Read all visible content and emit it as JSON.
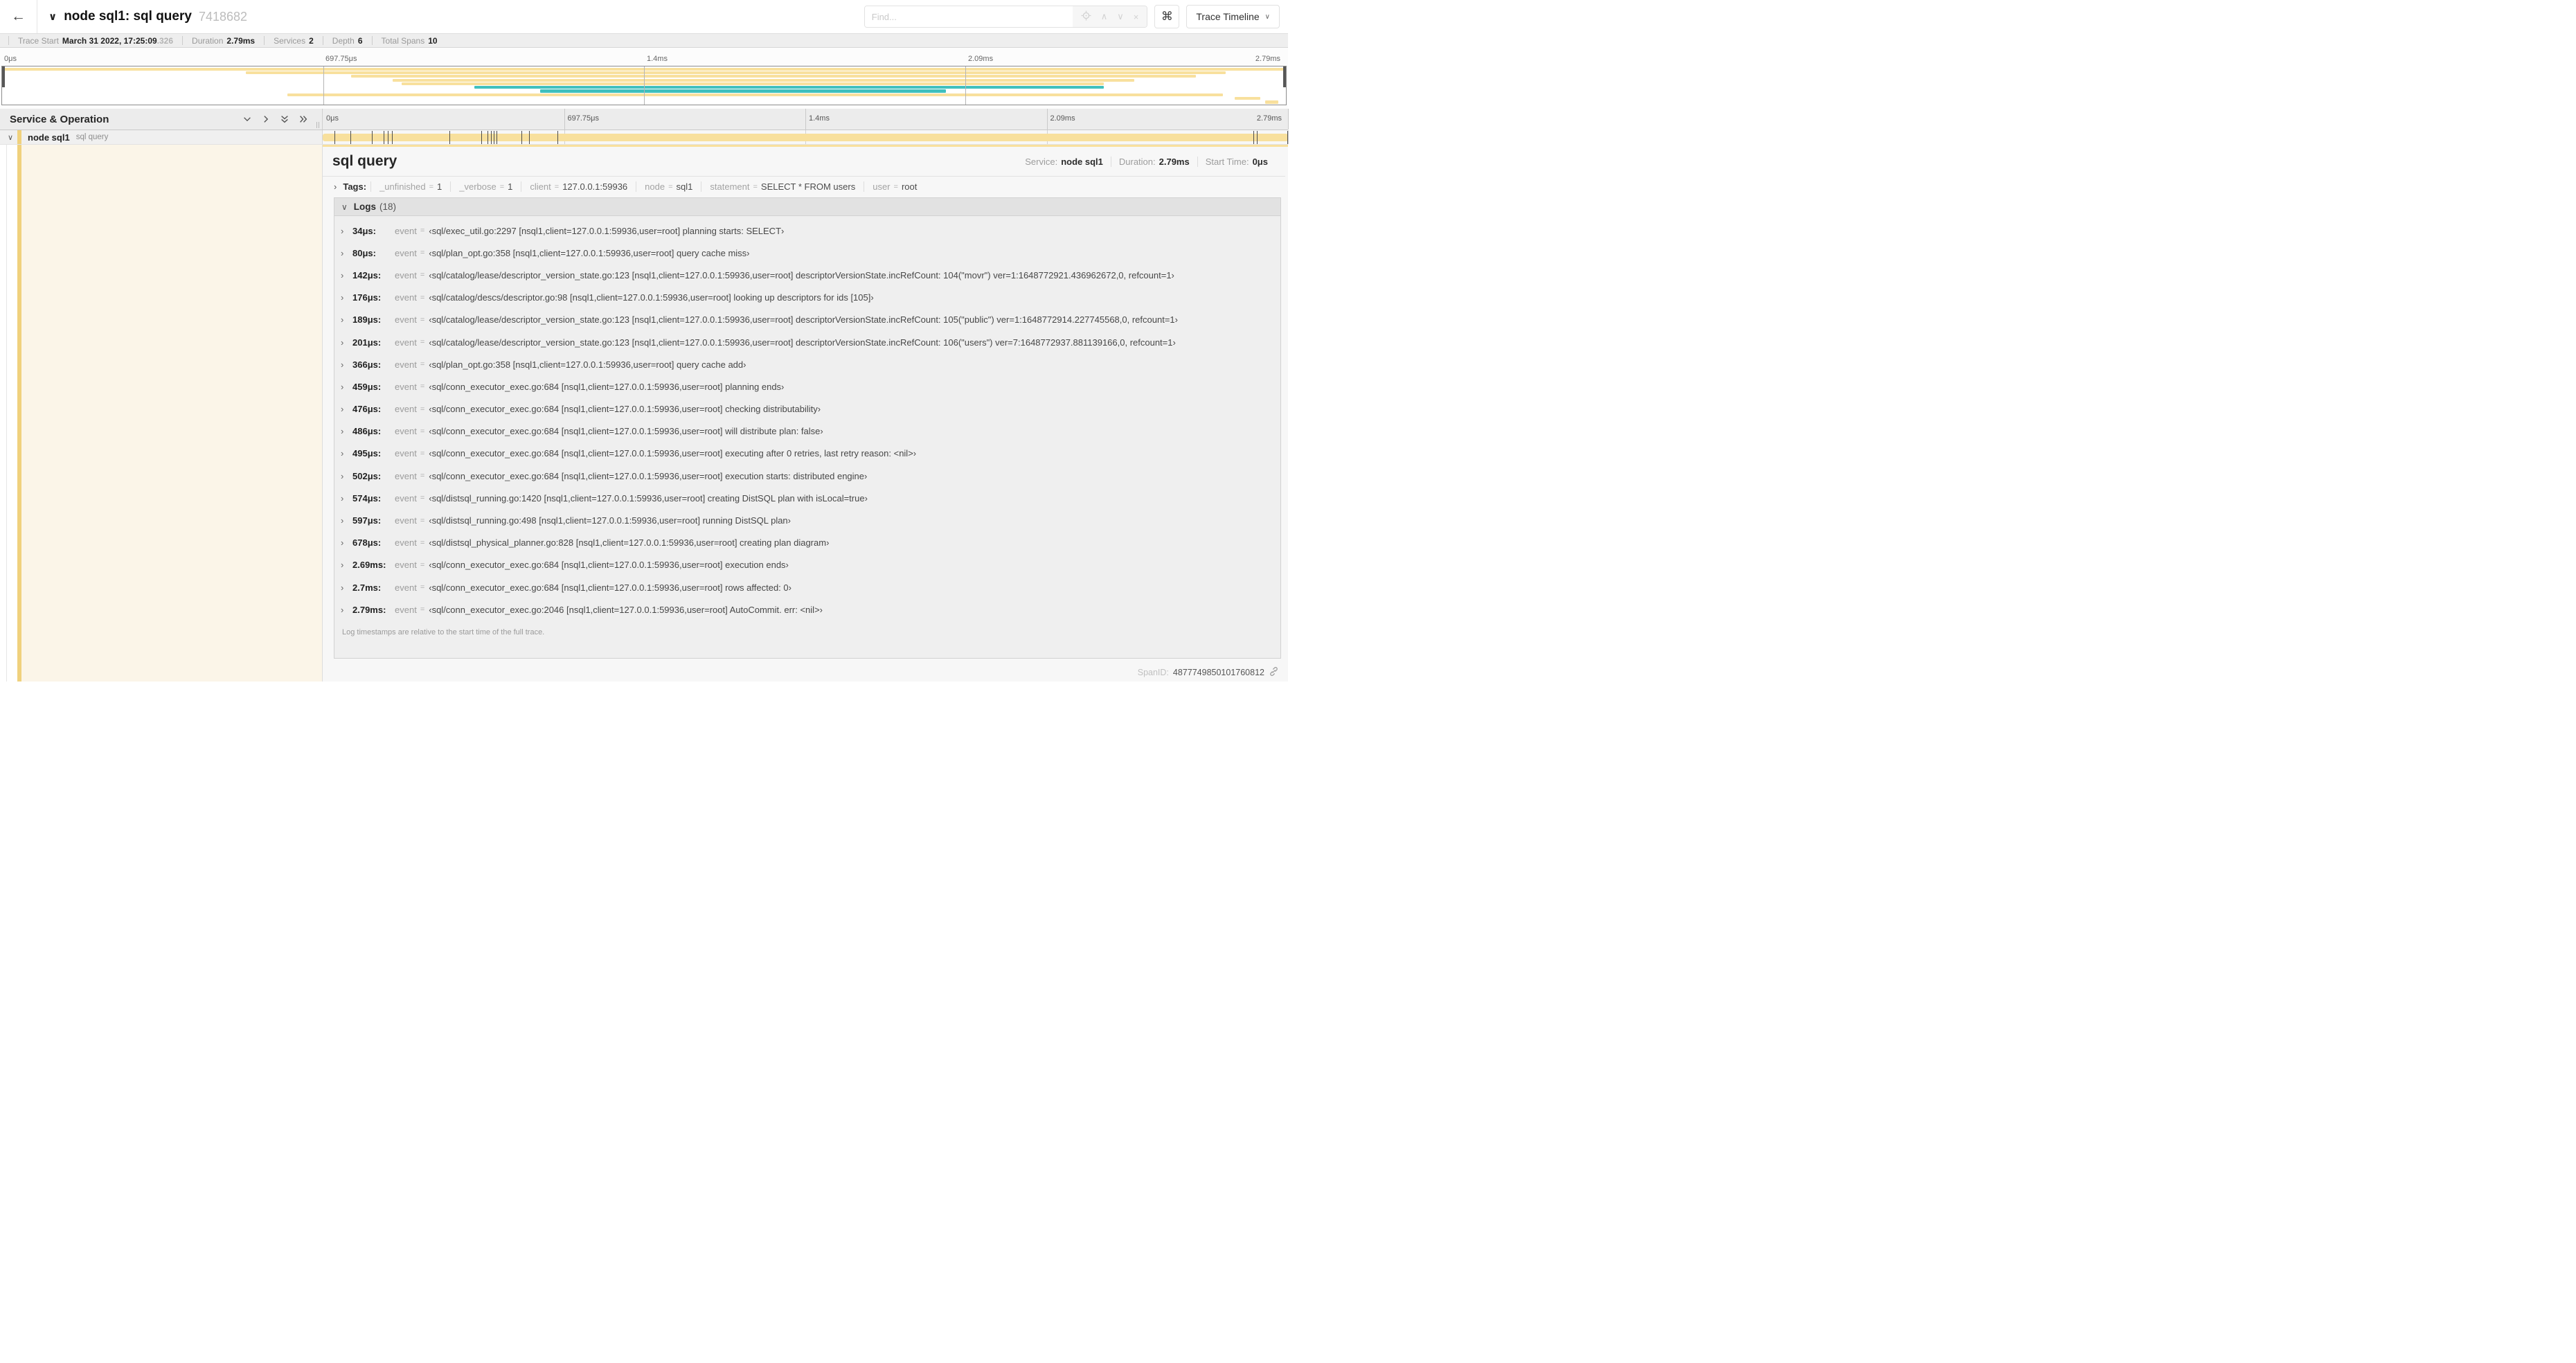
{
  "colors": {
    "span_bar": "#F8E09D",
    "accent": "#F0D17D",
    "teal": "#40C0BE",
    "cream_bg": "#FBF5E8"
  },
  "header": {
    "back_icon": "←",
    "collapse_icon": "∨",
    "title": "node sql1: sql query",
    "trace_id": "7418682",
    "find_placeholder": "Find...",
    "prev_icon": "∧",
    "next_icon": "∨",
    "clear_icon": "×",
    "shortcuts_icon": "⌘",
    "view_label": "Trace Timeline",
    "view_caret": "∨"
  },
  "trace_meta": [
    {
      "label": "Trace Start",
      "value": "March 31 2022, 17:25:09",
      "dim": ".326"
    },
    {
      "label": "Duration",
      "value": "2.79ms"
    },
    {
      "label": "Services",
      "value": "2"
    },
    {
      "label": "Depth",
      "value": "6"
    },
    {
      "label": "Total Spans",
      "value": "10"
    }
  ],
  "ruler_ticks": [
    {
      "label": "0μs",
      "pos": 0,
      "shift": "none"
    },
    {
      "label": "697.75μs",
      "pos": 25,
      "shift": "none"
    },
    {
      "label": "1.4ms",
      "pos": 50,
      "shift": "none"
    },
    {
      "label": "2.09ms",
      "pos": 75,
      "shift": "none"
    },
    {
      "label": "2.79ms",
      "pos": 100,
      "shift": "translateX(calc(-100% - 9px))"
    }
  ],
  "gridlines": [
    {
      "pos": 25
    },
    {
      "pos": 50
    },
    {
      "pos": 75
    },
    {
      "pos": 100
    }
  ],
  "minimap": {
    "gridlines": [
      {
        "pos": 25
      },
      {
        "pos": 50
      },
      {
        "pos": 75
      }
    ],
    "rows": [
      {
        "l": 0,
        "w": 100,
        "bg": "#F8E09D"
      },
      {
        "l": 19,
        "w": 76.3,
        "bg": "#F8E09D"
      },
      {
        "l": 27.2,
        "w": 65.8,
        "bg": "#F8E09D"
      },
      {
        "l": 30.4,
        "w": 57.8,
        "bg": "#F8E09D"
      },
      {
        "l": 31.1,
        "w": 54.7,
        "bg": "#F8E09D"
      },
      {
        "l": 36.8,
        "w": 49,
        "bg": "#40C0BE"
      },
      {
        "l": 41.9,
        "w": 31.6,
        "bg": "#40C0BE"
      },
      {
        "l": 22.2,
        "w": 72.9,
        "bg": "#F8E09D"
      },
      {
        "l": 96,
        "w": 2,
        "bg": "#F8E09D"
      },
      {
        "l": 98.4,
        "w": 1,
        "bg": "#F8E09D"
      }
    ]
  },
  "timeline": {
    "header_label": "Service & Operation",
    "row": {
      "service": "node sql1",
      "operation": "sql query"
    },
    "log_marks": [
      {
        "pos": 1.22
      },
      {
        "pos": 2.87
      },
      {
        "pos": 5.09
      },
      {
        "pos": 6.31
      },
      {
        "pos": 6.77
      },
      {
        "pos": 7.2
      },
      {
        "pos": 13.12
      },
      {
        "pos": 16.45
      },
      {
        "pos": 17.06
      },
      {
        "pos": 17.42
      },
      {
        "pos": 17.74
      },
      {
        "pos": 17.99
      },
      {
        "pos": 20.57
      },
      {
        "pos": 21.4
      },
      {
        "pos": 24.3
      },
      {
        "pos": 96.42
      },
      {
        "pos": 96.77
      },
      {
        "pos": 99.9
      }
    ]
  },
  "icons": {
    "chevron_down": "∨",
    "chevron_right": "›"
  },
  "detail": {
    "title": "sql query",
    "service_label": "Service:",
    "service": "node sql1",
    "duration_label": "Duration:",
    "duration": "2.79ms",
    "start_label": "Start Time:",
    "start": "0μs",
    "tags_label": "Tags:",
    "eq": "=",
    "tags": [
      {
        "k": "_unfinished",
        "v": "1"
      },
      {
        "k": "_verbose",
        "v": "1"
      },
      {
        "k": "client",
        "v": "127.0.0.1:59936"
      },
      {
        "k": "node",
        "v": "sql1"
      },
      {
        "k": "statement",
        "v": "SELECT * FROM users"
      },
      {
        "k": "user",
        "v": "root"
      }
    ],
    "logs_label": "Logs",
    "logs_count": "(18)",
    "log_key": "event",
    "logs": [
      {
        "t": "34μs:",
        "v": "‹sql/exec_util.go:2297 [nsql1,client=127.0.0.1:59936,user=root] planning starts: SELECT›"
      },
      {
        "t": "80μs:",
        "v": "‹sql/plan_opt.go:358 [nsql1,client=127.0.0.1:59936,user=root] query cache miss›"
      },
      {
        "t": "142μs:",
        "v": "‹sql/catalog/lease/descriptor_version_state.go:123 [nsql1,client=127.0.0.1:59936,user=root] descriptorVersionState.incRefCount: 104(\"movr\") ver=1:1648772921.436962672,0, refcount=1›"
      },
      {
        "t": "176μs:",
        "v": "‹sql/catalog/descs/descriptor.go:98 [nsql1,client=127.0.0.1:59936,user=root] looking up descriptors for ids [105]›"
      },
      {
        "t": "189μs:",
        "v": "‹sql/catalog/lease/descriptor_version_state.go:123 [nsql1,client=127.0.0.1:59936,user=root] descriptorVersionState.incRefCount: 105(\"public\") ver=1:1648772914.227745568,0, refcount=1›"
      },
      {
        "t": "201μs:",
        "v": "‹sql/catalog/lease/descriptor_version_state.go:123 [nsql1,client=127.0.0.1:59936,user=root] descriptorVersionState.incRefCount: 106(\"users\") ver=7:1648772937.881139166,0, refcount=1›"
      },
      {
        "t": "366μs:",
        "v": "‹sql/plan_opt.go:358 [nsql1,client=127.0.0.1:59936,user=root] query cache add›"
      },
      {
        "t": "459μs:",
        "v": "‹sql/conn_executor_exec.go:684 [nsql1,client=127.0.0.1:59936,user=root] planning ends›"
      },
      {
        "t": "476μs:",
        "v": "‹sql/conn_executor_exec.go:684 [nsql1,client=127.0.0.1:59936,user=root] checking distributability›"
      },
      {
        "t": "486μs:",
        "v": "‹sql/conn_executor_exec.go:684 [nsql1,client=127.0.0.1:59936,user=root] will distribute plan: false›"
      },
      {
        "t": "495μs:",
        "v": "‹sql/conn_executor_exec.go:684 [nsql1,client=127.0.0.1:59936,user=root] executing after 0 retries, last retry reason: <nil>›"
      },
      {
        "t": "502μs:",
        "v": "‹sql/conn_executor_exec.go:684 [nsql1,client=127.0.0.1:59936,user=root] execution starts: distributed engine›"
      },
      {
        "t": "574μs:",
        "v": "‹sql/distsql_running.go:1420 [nsql1,client=127.0.0.1:59936,user=root] creating DistSQL plan with isLocal=true›"
      },
      {
        "t": "597μs:",
        "v": "‹sql/distsql_running.go:498 [nsql1,client=127.0.0.1:59936,user=root] running DistSQL plan›"
      },
      {
        "t": "678μs:",
        "v": "‹sql/distsql_physical_planner.go:828 [nsql1,client=127.0.0.1:59936,user=root] creating plan diagram›"
      },
      {
        "t": "2.69ms:",
        "v": "‹sql/conn_executor_exec.go:684 [nsql1,client=127.0.0.1:59936,user=root] execution ends›"
      },
      {
        "t": "2.7ms:",
        "v": "‹sql/conn_executor_exec.go:684 [nsql1,client=127.0.0.1:59936,user=root] rows affected: 0›"
      },
      {
        "t": "2.79ms:",
        "v": "‹sql/conn_executor_exec.go:2046 [nsql1,client=127.0.0.1:59936,user=root] AutoCommit. err: <nil>›"
      }
    ],
    "footer": "Log timestamps are relative to the start time of the full trace.",
    "spanid_label": "SpanID:",
    "spanid": "4877749850101760812"
  }
}
